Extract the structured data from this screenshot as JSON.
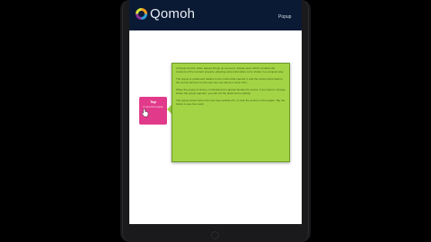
{
  "app": {
    "brand": "Qomoh",
    "nav_link": "Popup"
  },
  "tip": {
    "title": "Tap",
    "text": "to see the popup"
  },
  "popup": {
    "paragraphs": [
      "A Popup control, when tapped brings up a pop-up, display area, which contains the contents of the Content property, allowing extra information to be shown in a compact way.",
      "The popup is positioned relative to the control that opened it, and the arrow points back to the source element so the user can see where it came from.",
      "When the popup is shown, it will attempt to appear beside the source. If you want to change where the popup appears, you can set the placement explicitly.",
      "The popup closes when the user taps outside of it, or taps the source control again. Tap the button to see the result."
    ]
  },
  "colors": {
    "header_bg": "#0b1a34",
    "tip_bg": "#e23a8a",
    "popup_bg": "#a3d445"
  }
}
